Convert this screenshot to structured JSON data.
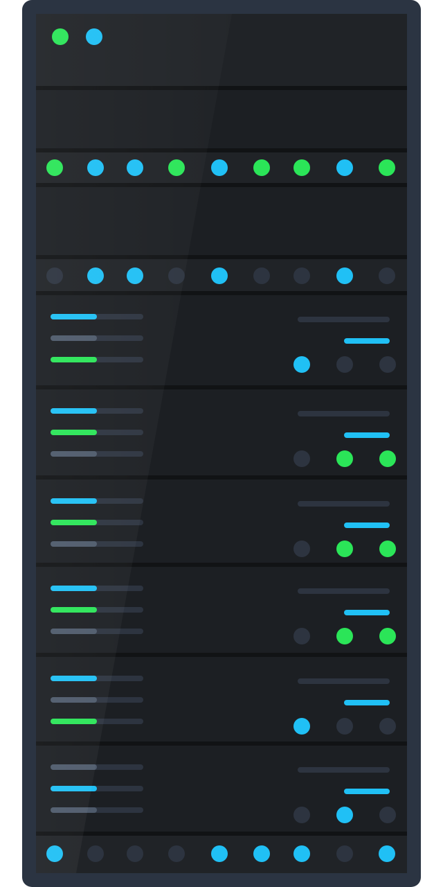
{
  "colors": {
    "frame": "#2b3442",
    "panel": "#1c1f23",
    "panel_alt": "#202327",
    "divider": "#111315",
    "led_green": "#2be558",
    "led_blue": "#20c0f5",
    "led_off": "#2d3440",
    "bar_track": "#2d3440",
    "bar_gray": "#4e5a6b"
  },
  "rack": {
    "top_unit_leds": [
      "green",
      "blue"
    ],
    "led_row_1": [
      "green",
      "blue",
      "blue",
      "green",
      "blue",
      "green",
      "green",
      "blue",
      "green"
    ],
    "led_row_2": [
      "off",
      "blue",
      "blue",
      "off",
      "blue",
      "off",
      "off",
      "blue",
      "off"
    ],
    "drive_units": [
      {
        "bars": [
          "blue",
          "gray",
          "green"
        ],
        "leds": [
          "blue",
          "off",
          "off"
        ]
      },
      {
        "bars": [
          "blue",
          "green",
          "gray"
        ],
        "leds": [
          "off",
          "green",
          "green"
        ]
      },
      {
        "bars": [
          "blue",
          "green",
          "gray"
        ],
        "leds": [
          "off",
          "green",
          "green"
        ]
      },
      {
        "bars": [
          "blue",
          "green",
          "gray"
        ],
        "leds": [
          "off",
          "green",
          "green"
        ]
      },
      {
        "bars": [
          "blue",
          "gray",
          "green"
        ],
        "leds": [
          "blue",
          "off",
          "off"
        ]
      },
      {
        "bars": [
          "gray",
          "blue",
          "gray"
        ],
        "leds": [
          "off",
          "blue",
          "off"
        ]
      }
    ],
    "bottom_led_row": [
      "blue",
      "off",
      "off",
      "off",
      "blue",
      "blue",
      "blue",
      "off",
      "blue"
    ]
  }
}
